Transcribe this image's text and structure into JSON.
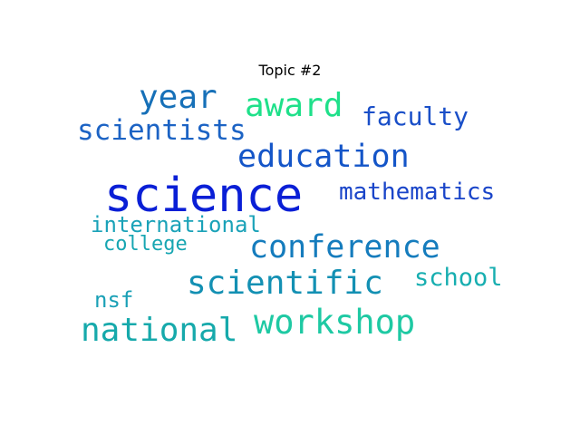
{
  "title": "Topic #2",
  "words": [
    {
      "text": "science",
      "color": "#0a1fd6"
    },
    {
      "text": "year",
      "color": "#1670b8"
    },
    {
      "text": "award",
      "color": "#1fe08a"
    },
    {
      "text": "faculty",
      "color": "#1a4fc8"
    },
    {
      "text": "scientists",
      "color": "#1c63c4"
    },
    {
      "text": "education",
      "color": "#1455c8"
    },
    {
      "text": "mathematics",
      "color": "#1a45c9"
    },
    {
      "text": "international",
      "color": "#1aa2b8"
    },
    {
      "text": "college",
      "color": "#17a6b2"
    },
    {
      "text": "conference",
      "color": "#157cbd"
    },
    {
      "text": "scientific",
      "color": "#1390b3"
    },
    {
      "text": "school",
      "color": "#17aeb0"
    },
    {
      "text": "nsf",
      "color": "#1aa0b6"
    },
    {
      "text": "national",
      "color": "#16a9ab"
    },
    {
      "text": "workshop",
      "color": "#1ec9a3"
    }
  ]
}
